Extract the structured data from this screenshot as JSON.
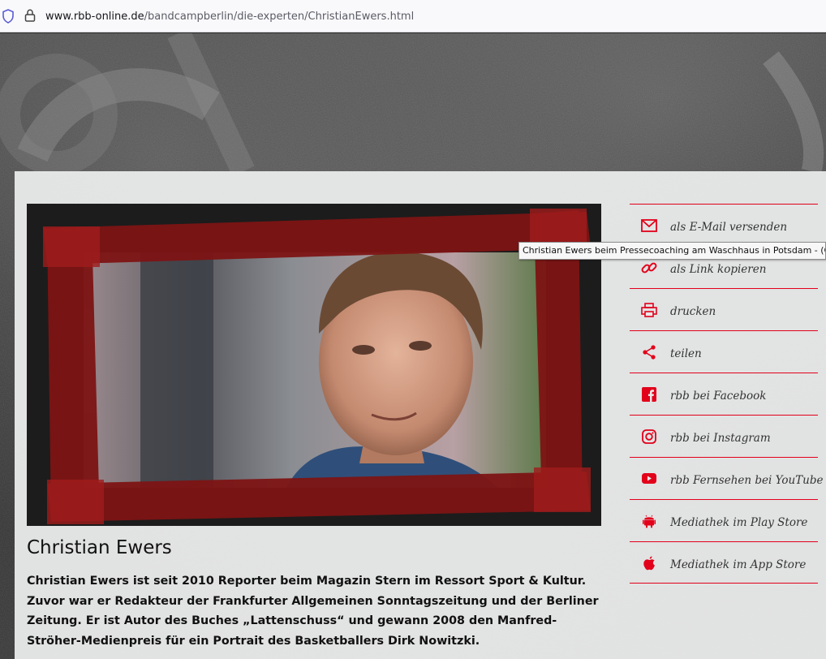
{
  "browser": {
    "url_host": "www.rbb-online.de",
    "url_path": "/bandcampberlin/die-experten/ChristianEwers.html"
  },
  "article": {
    "name": "Christian Ewers",
    "bio": "Christian Ewers ist seit 2010 Reporter beim Magazin Stern im Ressort Sport & Kultur. Zuvor war er Redakteur der Frankfurter Allgemeinen Sonntagszeitung und der Berliner Zeitung. Er ist Autor des Buches „Lattenschuss“ und gewann 2008 den Manfred-Ströher-Medienpreis für ein Portrait des Basketballers Dirk Nowitzki.",
    "image_tooltip": "Christian Ewers beim Pressecoaching am Waschhaus in Potsdam - (C) D"
  },
  "share": {
    "items": [
      {
        "label": "als E-Mail versenden",
        "icon": "mail-icon"
      },
      {
        "label": "als Link kopieren",
        "icon": "link-icon"
      },
      {
        "label": "drucken",
        "icon": "printer-icon"
      },
      {
        "label": "teilen",
        "icon": "share-icon"
      },
      {
        "label": "rbb bei Facebook",
        "icon": "facebook-icon"
      },
      {
        "label": "rbb bei Instagram",
        "icon": "instagram-icon"
      },
      {
        "label": "rbb Fernsehen bei YouTube",
        "icon": "youtube-icon"
      },
      {
        "label": "Mediathek im Play Store",
        "icon": "android-icon"
      },
      {
        "label": "Mediathek im App Store",
        "icon": "apple-icon"
      }
    ]
  },
  "colors": {
    "accent": "#e2001a",
    "frame_red": "#7d1414",
    "text": "#111111"
  }
}
